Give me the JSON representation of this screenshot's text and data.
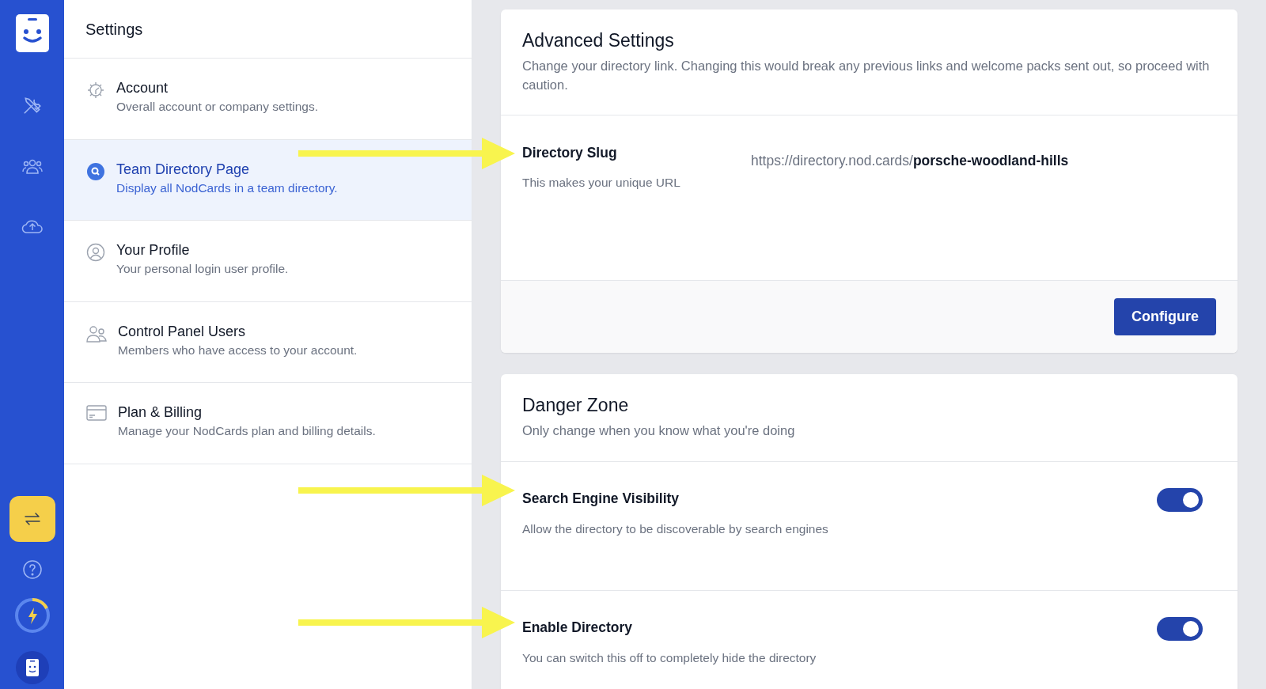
{
  "rail": {
    "items": [
      {
        "kind": "logo"
      },
      {
        "kind": "tools"
      },
      {
        "kind": "team"
      },
      {
        "kind": "upload"
      }
    ],
    "bottom_items": [
      {
        "kind": "switch",
        "selected": true
      },
      {
        "kind": "help"
      },
      {
        "kind": "power"
      },
      {
        "kind": "avatar"
      }
    ]
  },
  "settings_nav": {
    "title": "Settings",
    "items": [
      {
        "label": "Account",
        "description": "Overall account or company settings.",
        "selected": false
      },
      {
        "label": "Team Directory Page",
        "description": "Display all NodCards in a team directory.",
        "selected": true
      },
      {
        "label": "Your Profile",
        "description": "Your personal login user profile.",
        "selected": false
      },
      {
        "label": "Control Panel Users",
        "description": "Members who have access to your account.",
        "selected": false
      },
      {
        "label": "Plan & Billing",
        "description": "Manage your NodCards plan and billing details.",
        "selected": false
      }
    ]
  },
  "advanced_settings": {
    "title": "Advanced Settings",
    "description": "Change your directory link. Changing this would break any previous links and welcome packs sent out, so proceed with caution.",
    "slug_label": "Directory Slug",
    "slug_hint": "This makes your unique URL",
    "slug_url": "https://directory.nod.cards/**porsche-woodland-hills**",
    "button": "Configure"
  },
  "danger_zone": {
    "title": "Danger Zone",
    "description": "Only change when you know what you're doing",
    "settings": [
      {
        "label": "Search Engine Visibility",
        "description": "Allow the directory to be discoverable by search engines",
        "on": true
      },
      {
        "label": "Enable Directory",
        "description": "You can switch this off to completely hide the directory",
        "on": true
      }
    ]
  },
  "annotations": [
    {
      "kind": "arrow"
    },
    {
      "kind": "arrow"
    },
    {
      "kind": "arrow"
    }
  ]
}
